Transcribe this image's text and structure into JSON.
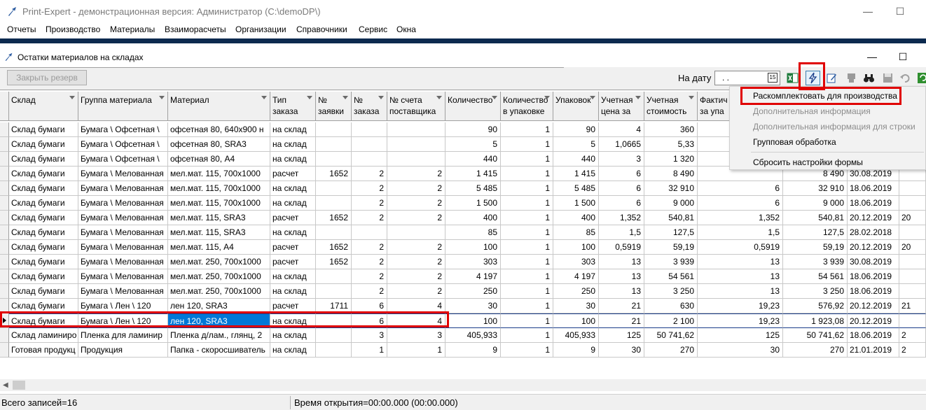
{
  "window": {
    "title": "Print-Expert - демонстрационная версия: Администратор (C:\\demoDP\\)",
    "minimize": "—",
    "maximize": "☐"
  },
  "menu": [
    "Отчеты",
    "Производство",
    "Материалы",
    "Взаиморасчеты",
    "Организации",
    "Справочники",
    "Сервис",
    "Окна"
  ],
  "child": {
    "title": "Остатки материалов на складах",
    "minimize": "—",
    "maximize": "☐"
  },
  "toolbar": {
    "close_reserve": "Закрыть резерв",
    "date_label": "На дату",
    "date_value": ". .",
    "calendar_label": "15"
  },
  "columns": [
    [
      "Склад",
      ""
    ],
    [
      "Группа материала",
      ""
    ],
    [
      "Материал",
      ""
    ],
    [
      "Тип",
      "заказа"
    ],
    [
      "№",
      "заявки"
    ],
    [
      "№",
      "заказа"
    ],
    [
      "№ счета",
      "поставщика"
    ],
    [
      "Количество",
      ""
    ],
    [
      "Количество",
      "в упаковке"
    ],
    [
      "Упаковок",
      ""
    ],
    [
      "Учетная",
      "цена за"
    ],
    [
      "Учетная",
      "стоимость"
    ],
    [
      "Фактич",
      "за упа"
    ],
    [
      "",
      ""
    ],
    [
      "",
      ""
    ],
    [
      "",
      ""
    ]
  ],
  "rows": [
    [
      "Склад бумаги",
      "Бумага \\ Офсетная \\",
      "офсетная 80, 640х900 н",
      "на склад",
      "",
      "",
      "",
      "90",
      "1",
      "90",
      "4",
      "360",
      "",
      "",
      "",
      ""
    ],
    [
      "Склад бумаги",
      "Бумага \\ Офсетная \\",
      "офсетная 80, SRA3",
      "на склад",
      "",
      "",
      "",
      "5",
      "1",
      "5",
      "1,0665",
      "5,33",
      "",
      "",
      "",
      ""
    ],
    [
      "Склад бумаги",
      "Бумага \\ Офсетная \\",
      "офсетная 80, А4",
      "на склад",
      "",
      "",
      "",
      "440",
      "1",
      "440",
      "3",
      "1 320",
      "",
      "",
      "",
      ""
    ],
    [
      "Склад бумаги",
      "Бумага \\ Мелованная",
      "мел.мат. 115, 700х1000",
      "расчет",
      "1652",
      "2",
      "2",
      "1 415",
      "1",
      "1 415",
      "6",
      "8 490",
      "",
      "8 490",
      "30.08.2019",
      ""
    ],
    [
      "Склад бумаги",
      "Бумага \\ Мелованная",
      "мел.мат. 115, 700х1000",
      "на склад",
      "",
      "2",
      "2",
      "5 485",
      "1",
      "5 485",
      "6",
      "32 910",
      "6",
      "32 910",
      "18.06.2019",
      ""
    ],
    [
      "Склад бумаги",
      "Бумага \\ Мелованная",
      "мел.мат. 115, 700х1000",
      "на склад",
      "",
      "2",
      "2",
      "1 500",
      "1",
      "1 500",
      "6",
      "9 000",
      "6",
      "9 000",
      "18.06.2019",
      ""
    ],
    [
      "Склад бумаги",
      "Бумага \\ Мелованная",
      "мел.мат. 115, SRA3",
      "расчет",
      "1652",
      "2",
      "2",
      "400",
      "1",
      "400",
      "1,352",
      "540,81",
      "1,352",
      "540,81",
      "20.12.2019",
      "20"
    ],
    [
      "Склад бумаги",
      "Бумага \\ Мелованная",
      "мел.мат. 115, SRA3",
      "на склад",
      "",
      "",
      "",
      "85",
      "1",
      "85",
      "1,5",
      "127,5",
      "1,5",
      "127,5",
      "28.02.2018",
      ""
    ],
    [
      "Склад бумаги",
      "Бумага \\ Мелованная",
      "мел.мат. 115, А4",
      "расчет",
      "1652",
      "2",
      "2",
      "100",
      "1",
      "100",
      "0,5919",
      "59,19",
      "0,5919",
      "59,19",
      "20.12.2019",
      "20"
    ],
    [
      "Склад бумаги",
      "Бумага \\ Мелованная",
      "мел.мат. 250, 700х1000",
      "расчет",
      "1652",
      "2",
      "2",
      "303",
      "1",
      "303",
      "13",
      "3 939",
      "13",
      "3 939",
      "30.08.2019",
      ""
    ],
    [
      "Склад бумаги",
      "Бумага \\ Мелованная",
      "мел.мат. 250, 700х1000",
      "на склад",
      "",
      "2",
      "2",
      "4 197",
      "1",
      "4 197",
      "13",
      "54 561",
      "13",
      "54 561",
      "18.06.2019",
      ""
    ],
    [
      "Склад бумаги",
      "Бумага \\ Мелованная",
      "мел.мат. 250, 700х1000",
      "на склад",
      "",
      "2",
      "2",
      "250",
      "1",
      "250",
      "13",
      "3 250",
      "13",
      "3 250",
      "18.06.2019",
      ""
    ],
    [
      "Склад бумаги",
      "Бумага \\ Лен \\ 120",
      "лен 120, SRA3",
      "расчет",
      "1711",
      "6",
      "4",
      "30",
      "1",
      "30",
      "21",
      "630",
      "19,23",
      "576,92",
      "20.12.2019",
      "21"
    ],
    [
      "Склад бумаги",
      "Бумага \\ Лен \\ 120",
      "лен 120, SRA3",
      "на склад",
      "",
      "6",
      "4",
      "100",
      "1",
      "100",
      "21",
      "2 100",
      "19,23",
      "1 923,08",
      "20.12.2019",
      ""
    ],
    [
      "Склад ламиниро",
      "Пленка для ламинир",
      "Пленка д/лам., глянц, 2",
      "на склад",
      "",
      "3",
      "3",
      "405,933",
      "1",
      "405,933",
      "125",
      "50 741,62",
      "125",
      "50 741,62",
      "18.06.2019",
      "2"
    ],
    [
      "Готовая продукц",
      "Продукция",
      "Папка - скоросшиватель",
      "на склад",
      "",
      "1",
      "1",
      "9",
      "1",
      "9",
      "30",
      "270",
      "30",
      "270",
      "21.01.2019",
      "2"
    ]
  ],
  "context_menu": {
    "items": [
      {
        "label": "Раскомплектовать для производства",
        "disabled": false
      },
      {
        "label": "Дополнительная информация",
        "disabled": true
      },
      {
        "label": "Дополнительная информация для строки",
        "disabled": true
      },
      {
        "label": "Групповая обработка",
        "disabled": false
      },
      {
        "label": "Сбросить настройки формы",
        "disabled": false
      }
    ]
  },
  "status": {
    "records": "Всего записей=16",
    "open_time": "Время открытия=00:00.000 (00:00.000)"
  },
  "scroll": {
    "left_arrow": "◀"
  },
  "colors": {
    "selection": "#0078d7",
    "highlight_box": "#e00000",
    "dark_band": "#0c2a4f"
  }
}
